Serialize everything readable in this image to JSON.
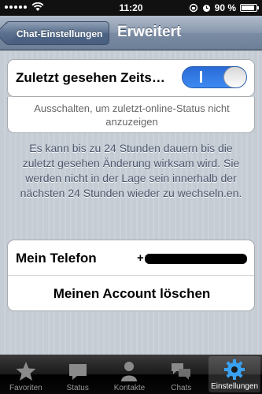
{
  "status_bar": {
    "time": "11:20",
    "battery": "90 %",
    "battery_level": 0.9
  },
  "nav": {
    "back_label": "Chat-Einstellungen",
    "title": "Erweitert"
  },
  "last_seen": {
    "label": "Zuletzt gesehen Zeits…",
    "enabled": true,
    "hint": "Ausschalten, um zuletzt-online-Status nicht anzuzeigen"
  },
  "info_text": "Es kann bis zu 24 Stunden dauern bis die zuletzt gesehen Änderung wirksam wird. Sie werden nicht in der Lage sein innerhalb der nächsten 24 Stunden wieder zu wechseln.en.",
  "account": {
    "phone_label": "Mein Telefon",
    "phone_value": "+",
    "delete_label": "Meinen Account löschen"
  },
  "tabs": [
    {
      "label": "Favoriten",
      "icon": "star-icon"
    },
    {
      "label": "Status",
      "icon": "speech-bubble-icon"
    },
    {
      "label": "Kontakte",
      "icon": "person-icon"
    },
    {
      "label": "Chats",
      "icon": "chat-bubbles-icon"
    },
    {
      "label": "Einstellungen",
      "icon": "gear-icon",
      "active": true
    }
  ]
}
